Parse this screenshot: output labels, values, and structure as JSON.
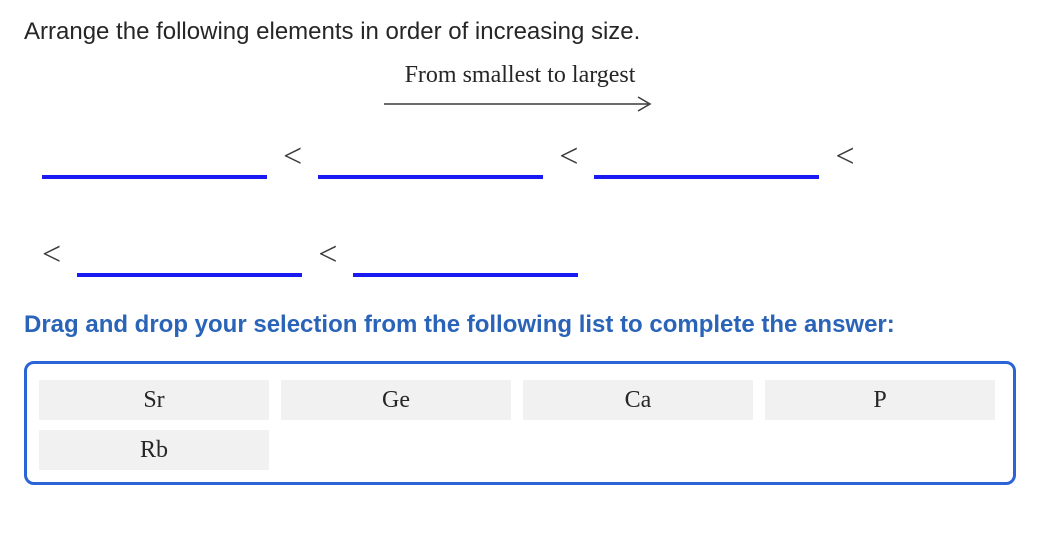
{
  "question": "Arrange the following elements in order of increasing size.",
  "direction_label": "From smallest to largest",
  "less_than": "<",
  "instruction": "Drag and drop your selection from the following list to complete the answer:",
  "options": [
    "Sr",
    "Ge",
    "Ca",
    "P",
    "Rb"
  ]
}
